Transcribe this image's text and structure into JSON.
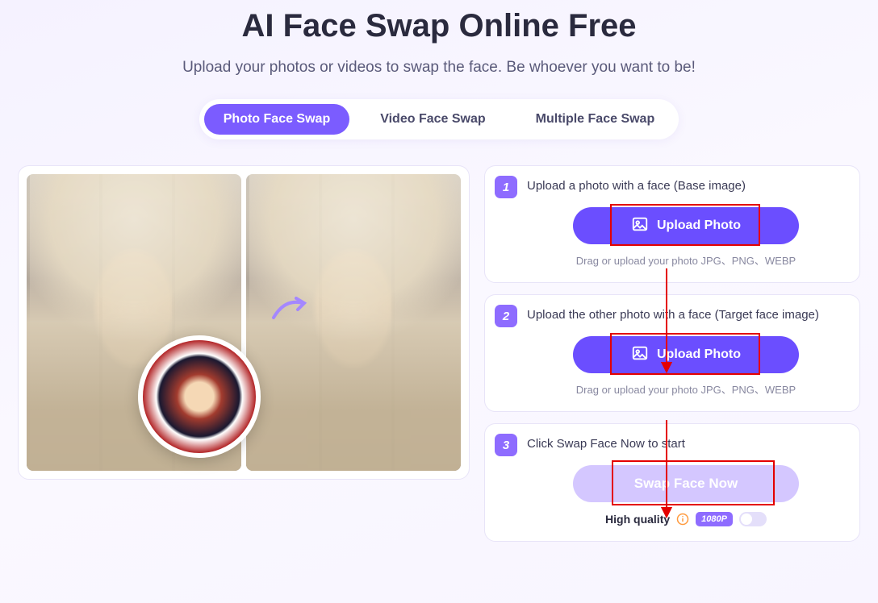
{
  "header": {
    "title": "AI Face Swap Online Free",
    "subtitle": "Upload your photos or videos to swap the face. Be whoever you want to be!"
  },
  "tabs": [
    {
      "label": "Photo Face Swap",
      "active": true
    },
    {
      "label": "Video Face Swap",
      "active": false
    },
    {
      "label": "Multiple Face Swap",
      "active": false
    }
  ],
  "steps": {
    "s1": {
      "num": "1",
      "label": "Upload a photo with a face (Base image)",
      "button": "Upload Photo",
      "helper": "Drag or upload your photo JPG、PNG、WEBP"
    },
    "s2": {
      "num": "2",
      "label": "Upload the other photo with a face (Target face image)",
      "button": "Upload Photo",
      "helper": "Drag or upload your photo JPG、PNG、WEBP"
    },
    "s3": {
      "num": "3",
      "label": "Click Swap Face Now to start",
      "button": "Swap Face Now"
    }
  },
  "quality": {
    "label": "High quality",
    "badge": "1080P"
  }
}
